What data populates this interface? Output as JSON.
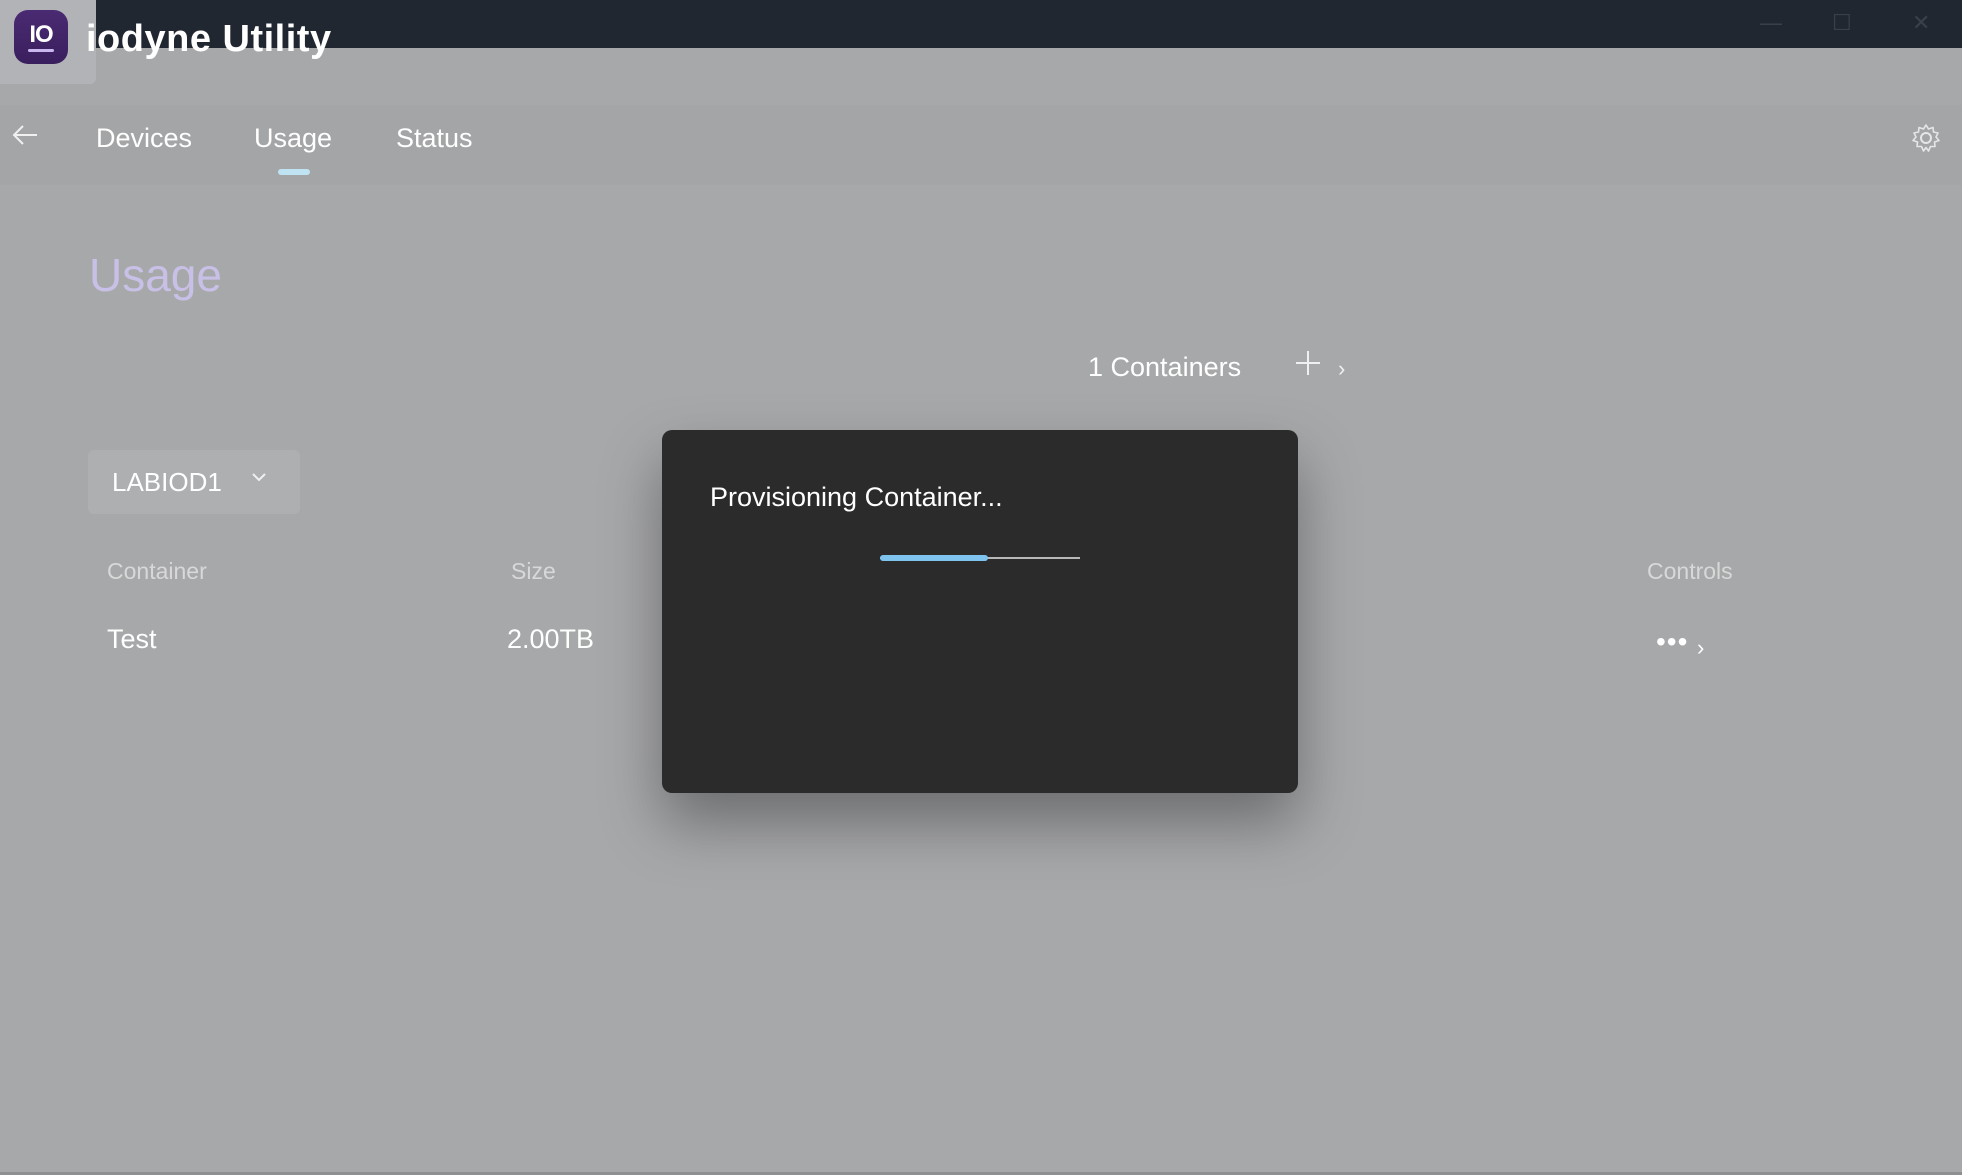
{
  "window": {
    "app_icon_text": "IO",
    "title": "iodyne Utility",
    "minimize": "—",
    "maximize": "☐",
    "close": "✕"
  },
  "nav": {
    "back_icon": "arrow-left-icon",
    "tabs": [
      {
        "label": "Devices"
      },
      {
        "label": "Usage",
        "selected": true
      },
      {
        "label": "Status"
      }
    ],
    "settings_icon": "gear-icon"
  },
  "page": {
    "title": "Usage",
    "containers_count": "1 Containers",
    "device_select": {
      "value": "LABIOD1"
    }
  },
  "table": {
    "headers": {
      "container": "Container",
      "size": "Size",
      "controls": "Controls"
    },
    "rows": [
      {
        "container": "Test",
        "size": "2.00TB",
        "more": "•••",
        "chevron": "›"
      }
    ]
  },
  "modal": {
    "title": "Provisioning Container...",
    "progress": 0.54,
    "progress_color": "#7ec4ef"
  },
  "colors": {
    "titlebar": "#202731",
    "overlay_bg": "#a7a8aa",
    "modal_bg": "#2b2b2b",
    "accent_tab": "#bfe3f2",
    "page_title": "#c8c0e6"
  }
}
